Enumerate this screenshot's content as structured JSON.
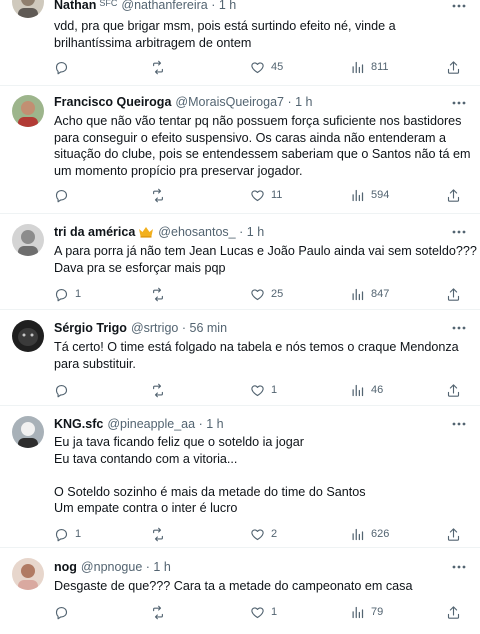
{
  "tweets": [
    {
      "name": "Nathan",
      "badge": "SFC",
      "handle": "@nathanfereira",
      "dot": "·",
      "time": "1 h",
      "lines": [
        "vdd, pra que brigar msm, pois está surtindo efeito né, vinde a",
        "brilhantíssima arbitragem de ontem"
      ],
      "replies": "",
      "retweets": "",
      "likes": "45",
      "views": "811",
      "avatar_color": "#c9c3b8"
    },
    {
      "name": "Francisco Queiroga",
      "handle": "@MoraisQueiroga7",
      "dot": "·",
      "time": "1 h",
      "lines": [
        "Acho que não vão tentar pq não possuem força suficiente nos bastidores",
        "para conseguir o efeito suspensivo. Os caras ainda não entenderam a",
        "situação do clube, pois se entendessem saberiam que o Santos não tá em",
        "um momento propício pra preservar jogador."
      ],
      "replies": "",
      "retweets": "",
      "likes": "11",
      "views": "594",
      "avatar_color": "#8aa37a"
    },
    {
      "name": "tri da américa",
      "handle": "@ehosantos_",
      "dot": "·",
      "time": "1 h",
      "lines": [
        "A para porra já não tem Jean Lucas e João Paulo ainda vai sem soteldo???",
        "Dava pra se esforçar mais pqp"
      ],
      "replies": "1",
      "retweets": "",
      "likes": "25",
      "views": "847",
      "avatar_color": "#b9b9b9"
    },
    {
      "name": "Sérgio Trigo",
      "handle": "@srtrigo",
      "dot": "·",
      "time": "56 min",
      "lines": [
        "Tá certo! O time está folgado na tabela e nós temos o craque Mendonza",
        "para substituir."
      ],
      "replies": "",
      "retweets": "",
      "likes": "1",
      "views": "46",
      "avatar_color": "#2b2b2b"
    },
    {
      "name": "KNG.sfc",
      "handle": "@pineapple_aa",
      "dot": "·",
      "time": "1 h",
      "lines": [
        "Eu ja tava ficando feliz que o soteldo ia jogar",
        "Eu tava contando com a vitoria...",
        "",
        "O Soteldo sozinho é mais da metade do time do Santos",
        "Um empate contra o inter é lucro"
      ],
      "replies": "1",
      "retweets": "",
      "likes": "2",
      "views": "626",
      "avatar_color": "#9aa4ad"
    },
    {
      "name": "nog",
      "handle": "@npnogue",
      "dot": "·",
      "time": "1 h",
      "lines": [
        "Desgaste de que??? Cara ta a metade do campeonato em casa"
      ],
      "replies": "",
      "retweets": "",
      "likes": "1",
      "views": "79",
      "avatar_color": "#c49a8a"
    }
  ],
  "colors": {
    "text": "#0f1419",
    "muted": "#536471",
    "divider": "#eff3f4",
    "crown": "#f2b01e"
  },
  "icons": {
    "reply": "reply-icon",
    "retweet": "retweet-icon",
    "like": "heart-icon",
    "views": "views-icon",
    "share": "share-icon",
    "more": "more-icon"
  }
}
